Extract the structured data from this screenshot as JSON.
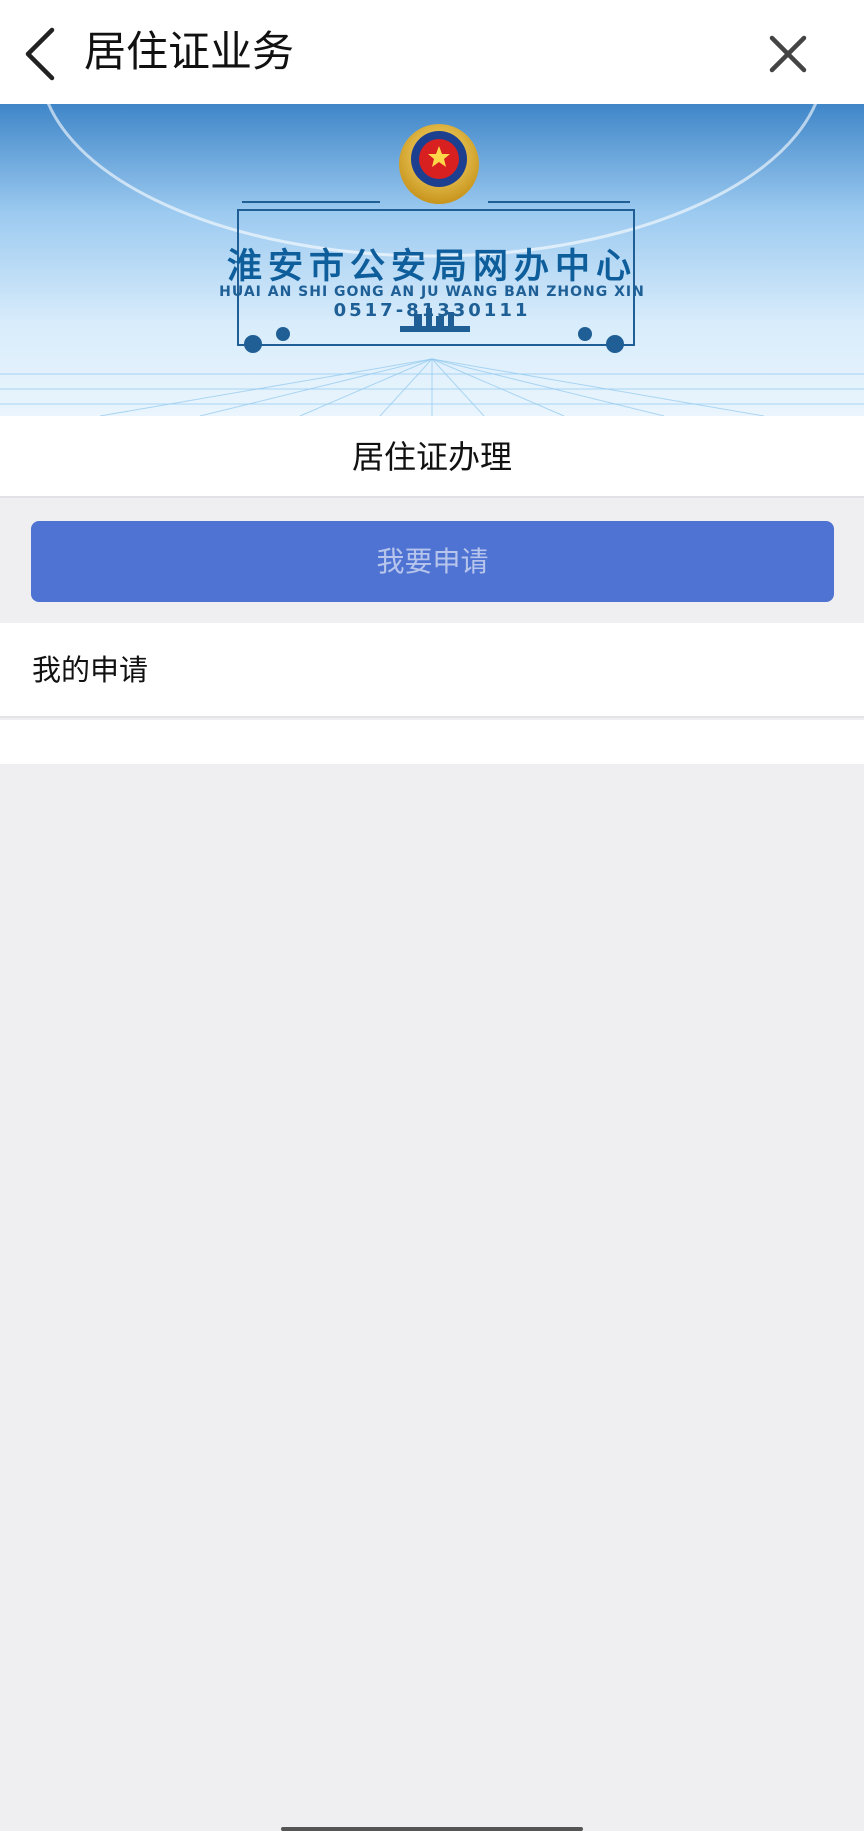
{
  "header": {
    "title": "居住证业务",
    "back_icon": "chevron-left-icon",
    "close_icon": "close-icon"
  },
  "banner": {
    "title": "淮安市公安局网办中心",
    "subtitle": "HUAI AN SHI GONG AN JU WANG BAN ZHONG XIN",
    "phone": "0517-81330111",
    "emblem_icon": "police-emblem-icon"
  },
  "section": {
    "title": "居住证办理"
  },
  "actions": {
    "apply_label": "我要申请"
  },
  "list": {
    "my_applications_label": "我的申请"
  },
  "colors": {
    "primary_button": "#4f73d2",
    "banner_text": "#0f5e9c",
    "page_background": "#efeff2"
  }
}
